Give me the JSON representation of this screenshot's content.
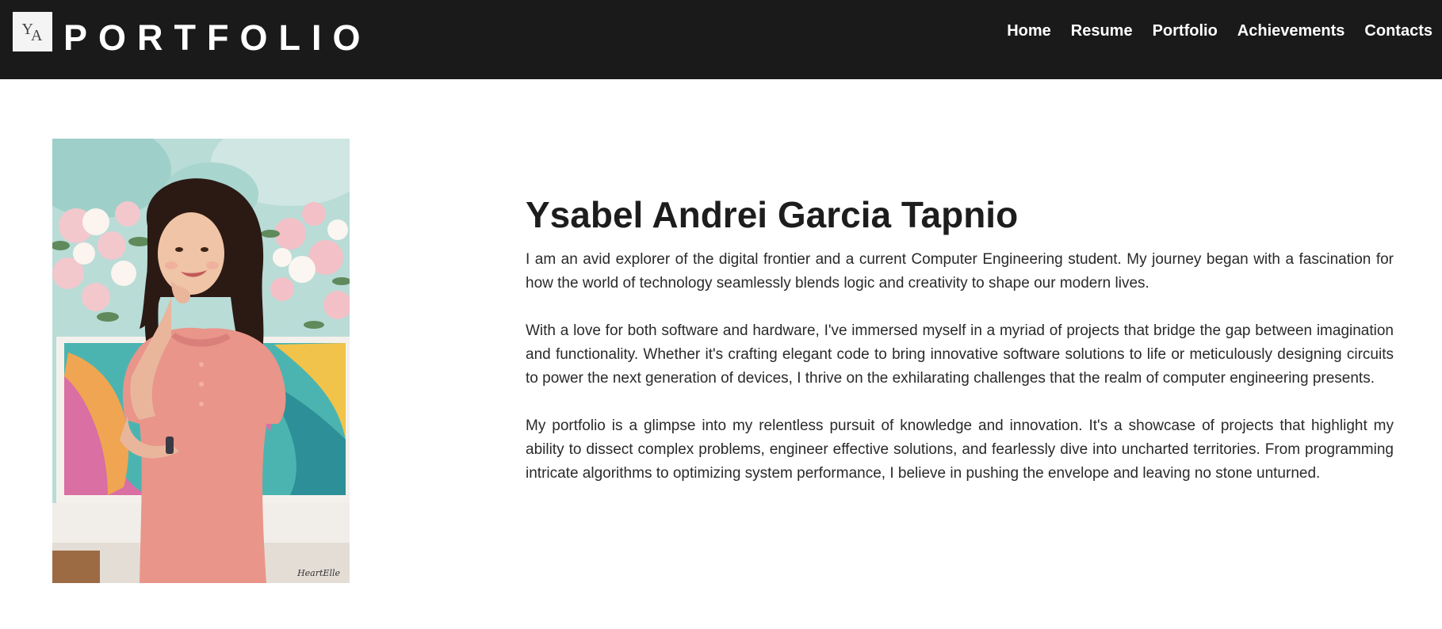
{
  "header": {
    "logo_text": "YA",
    "brand": "PORTFOLIO",
    "nav": [
      {
        "label": "Home"
      },
      {
        "label": "Resume"
      },
      {
        "label": "Portfolio"
      },
      {
        "label": "Achievements"
      },
      {
        "label": "Contacts"
      }
    ]
  },
  "profile": {
    "photo_signature": "HeartElle",
    "name": "Ysabel Andrei Garcia Tapnio",
    "paragraphs": [
      "I am an avid explorer of the digital frontier and a current Computer Engineering student. My journey began with a fascination for how the world of technology seamlessly blends logic and creativity to shape our modern lives.",
      "With a love for both software and hardware, I've immersed myself in a myriad of projects that bridge the gap between imagination and functionality. Whether it's crafting elegant code to bring innovative software solutions to life or meticulously designing circuits to power the next generation of devices, I thrive on the exhilarating challenges that the realm of computer engineering presents.",
      "My portfolio is a glimpse into my relentless pursuit of knowledge and innovation. It's a showcase of projects that highlight my ability to dissect complex problems, engineer effective solutions, and fearlessly dive into uncharted territories. From programming intricate algorithms to optimizing system performance, I believe in pushing the envelope and leaving no stone unturned."
    ]
  },
  "colors": {
    "header_bg": "#1a1a1a",
    "nav_text": "#ffffff",
    "body_bg": "#ffffff",
    "outfit_pink": "#e9958a"
  }
}
